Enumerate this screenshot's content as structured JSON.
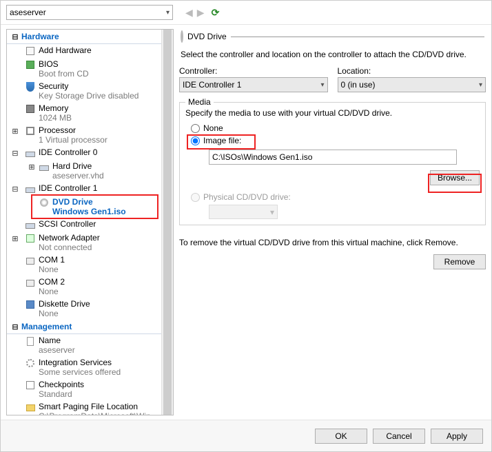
{
  "topbar": {
    "server_name": "aseserver"
  },
  "sidebar": {
    "hardware_label": "Hardware",
    "management_label": "Management",
    "items": {
      "add_hw": "Add Hardware",
      "bios": "BIOS",
      "bios_sub": "Boot from CD",
      "security": "Security",
      "security_sub": "Key Storage Drive disabled",
      "memory": "Memory",
      "memory_sub": "1024 MB",
      "processor": "Processor",
      "processor_sub": "1 Virtual processor",
      "ide0": "IDE Controller 0",
      "hd": "Hard Drive",
      "hd_sub": "aseserver.vhd",
      "ide1": "IDE Controller 1",
      "dvd": "DVD Drive",
      "dvd_sub": "Windows Gen1.iso",
      "scsi": "SCSI Controller",
      "net": "Network Adapter",
      "net_sub": "Not connected",
      "com1": "COM 1",
      "com1_sub": "None",
      "com2": "COM 2",
      "com2_sub": "None",
      "diskette": "Diskette Drive",
      "diskette_sub": "None",
      "name": "Name",
      "name_sub": "aseserver",
      "integ": "Integration Services",
      "integ_sub": "Some services offered",
      "checkpoints": "Checkpoints",
      "checkpoints_sub": "Standard",
      "paging": "Smart Paging File Location",
      "paging_sub": "C:\\ProgramData\\Microsoft\\Win..."
    }
  },
  "pane": {
    "title": "DVD Drive",
    "help": "Select the controller and location on the controller to attach the CD/DVD drive.",
    "controller_label": "Controller:",
    "controller_value": "IDE Controller 1",
    "location_label": "Location:",
    "location_value": "0 (in use)",
    "media_group": "Media",
    "media_help": "Specify the media to use with your virtual CD/DVD drive.",
    "radio_none": "None",
    "radio_image": "Image file:",
    "image_path": "C:\\ISOs\\Windows Gen1.iso",
    "browse": "Browse...",
    "radio_physical": "Physical CD/DVD drive:",
    "remove_help": "To remove the virtual CD/DVD drive from this virtual machine, click Remove.",
    "remove": "Remove"
  },
  "footer": {
    "ok": "OK",
    "cancel": "Cancel",
    "apply": "Apply"
  }
}
